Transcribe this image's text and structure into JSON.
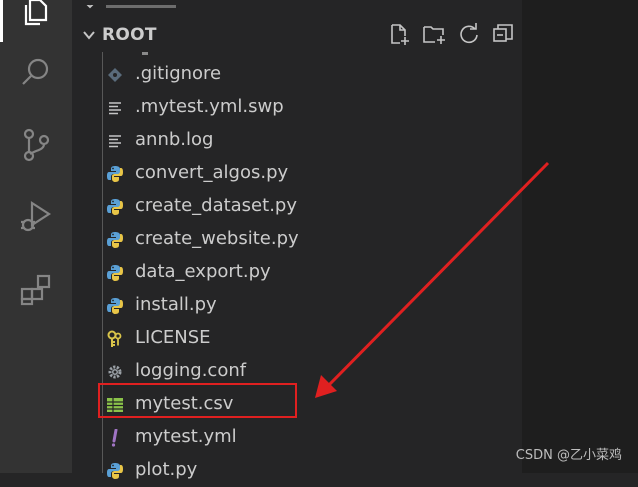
{
  "explorer": {
    "root_label": "ROOT",
    "actions": [
      "new-file-icon",
      "new-folder-icon",
      "refresh-icon",
      "collapse-all-icon"
    ],
    "files": [
      {
        "name": ".gitignore",
        "icon": "git-icon",
        "color": "#5a6b7b"
      },
      {
        "name": ".mytest.yml.swp",
        "icon": "lines-icon",
        "color": "#c5c5c5"
      },
      {
        "name": "annb.log",
        "icon": "lines-icon",
        "color": "#c5c5c5"
      },
      {
        "name": "convert_algos.py",
        "icon": "python-icon",
        "color": "#5aa0d6"
      },
      {
        "name": "create_dataset.py",
        "icon": "python-icon",
        "color": "#5aa0d6"
      },
      {
        "name": "create_website.py",
        "icon": "python-icon",
        "color": "#5aa0d6"
      },
      {
        "name": "data_export.py",
        "icon": "python-icon",
        "color": "#5aa0d6"
      },
      {
        "name": "install.py",
        "icon": "python-icon",
        "color": "#5aa0d6"
      },
      {
        "name": "LICENSE",
        "icon": "key-icon",
        "color": "#d9c44a"
      },
      {
        "name": "logging.conf",
        "icon": "gear-icon",
        "color": "#9aa0a6"
      },
      {
        "name": "mytest.csv",
        "icon": "table-icon",
        "color": "#8bc34a"
      },
      {
        "name": "mytest.yml",
        "icon": "exclamation-icon",
        "color": "#a074c4"
      },
      {
        "name": "plot.py",
        "icon": "python-icon",
        "color": "#5aa0d6"
      }
    ]
  },
  "annotation": {
    "color": "#e02020"
  },
  "watermark": "CSDN @乙小菜鸡"
}
